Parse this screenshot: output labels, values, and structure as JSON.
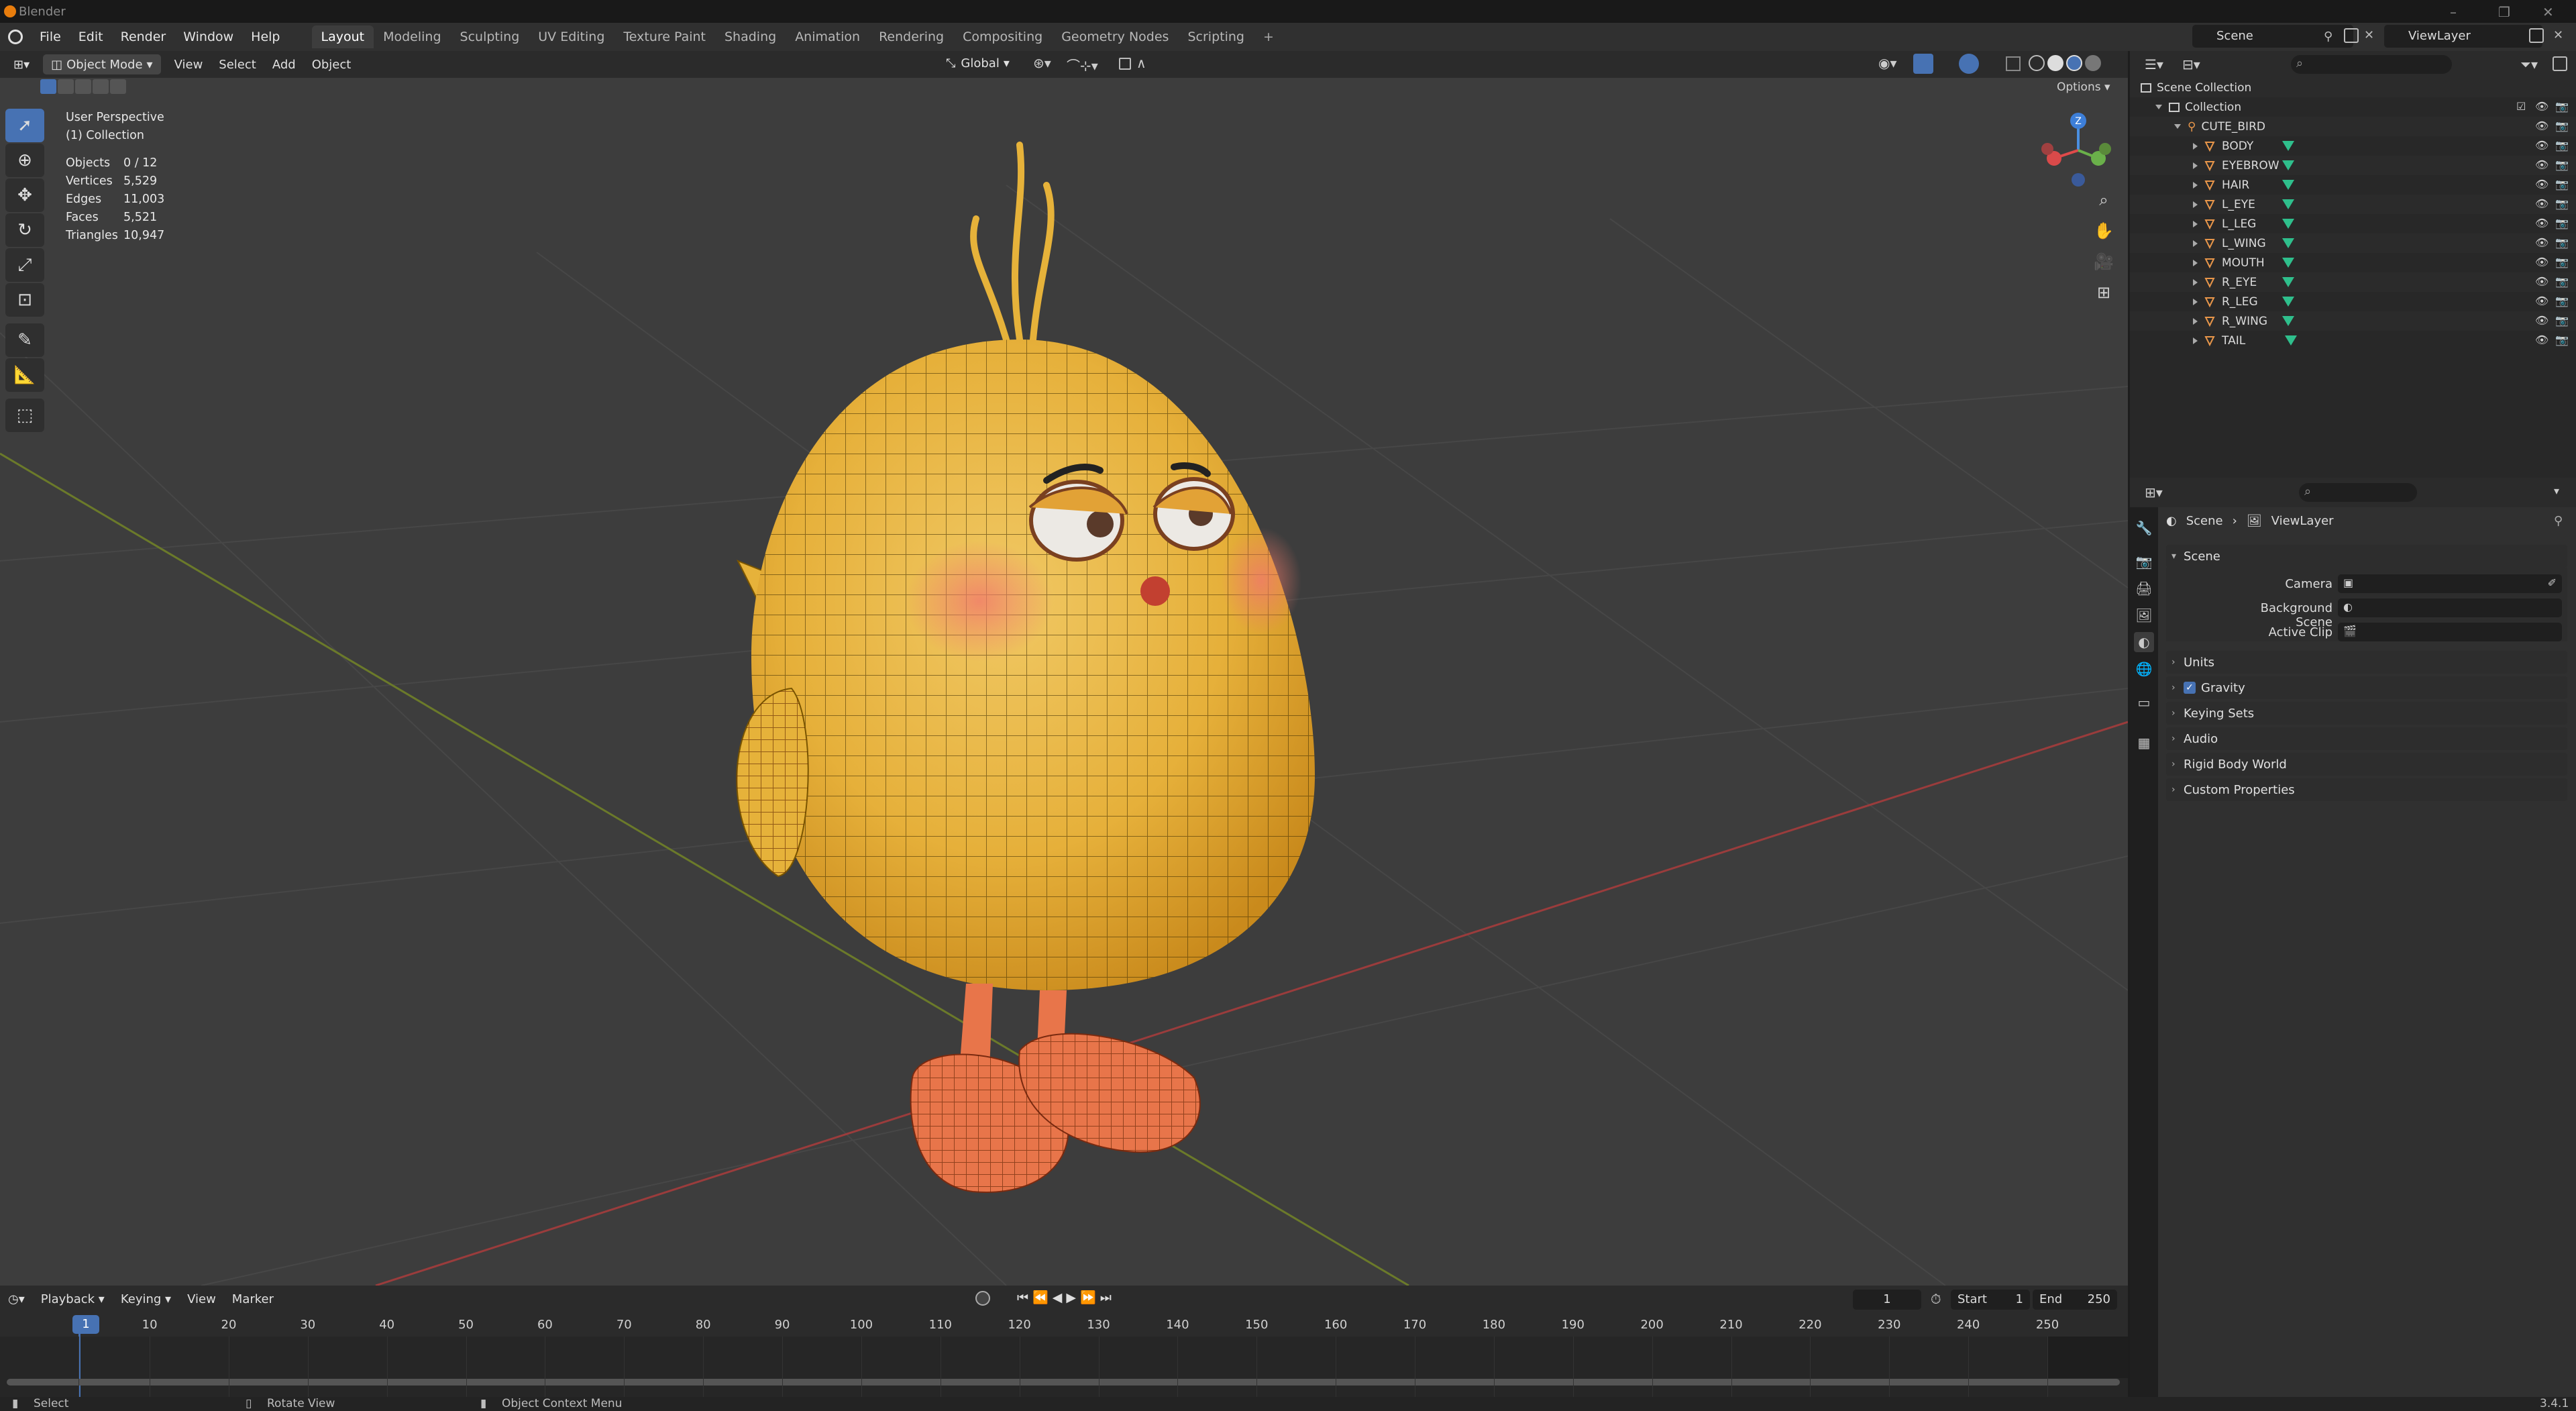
{
  "window": {
    "title": "Blender"
  },
  "menu": [
    "File",
    "Edit",
    "Render",
    "Window",
    "Help"
  ],
  "workspaces": {
    "active": "Layout",
    "tabs": [
      "Layout",
      "Modeling",
      "Sculpting",
      "UV Editing",
      "Texture Paint",
      "Shading",
      "Animation",
      "Rendering",
      "Compositing",
      "Geometry Nodes",
      "Scripting"
    ],
    "add": "+"
  },
  "scene_selector": {
    "scene": "Scene",
    "view_layer": "ViewLayer"
  },
  "viewport": {
    "mode": "Object Mode",
    "menu": [
      "View",
      "Select",
      "Add",
      "Object"
    ],
    "orientation": "Global",
    "options_label": "Options",
    "overlay": {
      "perspective": "User Perspective",
      "collection": "(1) Collection",
      "stats": [
        {
          "label": "Objects",
          "value": "0 / 12"
        },
        {
          "label": "Vertices",
          "value": "5,529"
        },
        {
          "label": "Edges",
          "value": "11,003"
        },
        {
          "label": "Faces",
          "value": "5,521"
        },
        {
          "label": "Triangles",
          "value": "10,947"
        }
      ]
    },
    "gizmo_axis": "Z",
    "model_colors": {
      "body": "#e6b23a",
      "legs": "#e8754a",
      "wire": "#2a2200"
    }
  },
  "timeline": {
    "menu": [
      "Playback",
      "Keying",
      "View",
      "Marker"
    ],
    "current_frame": "1",
    "start_label": "Start",
    "start": "1",
    "end_label": "End",
    "end": "250",
    "ticks": [
      "1",
      "10",
      "20",
      "30",
      "40",
      "50",
      "60",
      "70",
      "80",
      "90",
      "100",
      "110",
      "120",
      "130",
      "140",
      "150",
      "160",
      "170",
      "180",
      "190",
      "200",
      "210",
      "220",
      "230",
      "240",
      "250"
    ]
  },
  "status": {
    "select": "Select",
    "rotate": "Rotate View",
    "context": "Object Context Menu",
    "version": "3.4.1"
  },
  "outliner": {
    "scene_collection": "Scene Collection",
    "collection": "Collection",
    "armature": "CUTE_BIRD",
    "objects": [
      "BODY",
      "EYEBROW",
      "HAIR",
      "L_EYE",
      "L_LEG",
      "L_WING",
      "MOUTH",
      "R_EYE",
      "R_LEG",
      "R_WING",
      "TAIL"
    ]
  },
  "properties": {
    "breadcrumb": {
      "scene": "Scene",
      "view_layer": "ViewLayer"
    },
    "panel": "Scene",
    "fields": [
      {
        "label": "Camera"
      },
      {
        "label": "Background Scene"
      },
      {
        "label": "Active Clip"
      }
    ],
    "sections": [
      "Units",
      "Gravity",
      "Keying Sets",
      "Audio",
      "Rigid Body World",
      "Custom Properties"
    ],
    "gravity_checked": true
  }
}
